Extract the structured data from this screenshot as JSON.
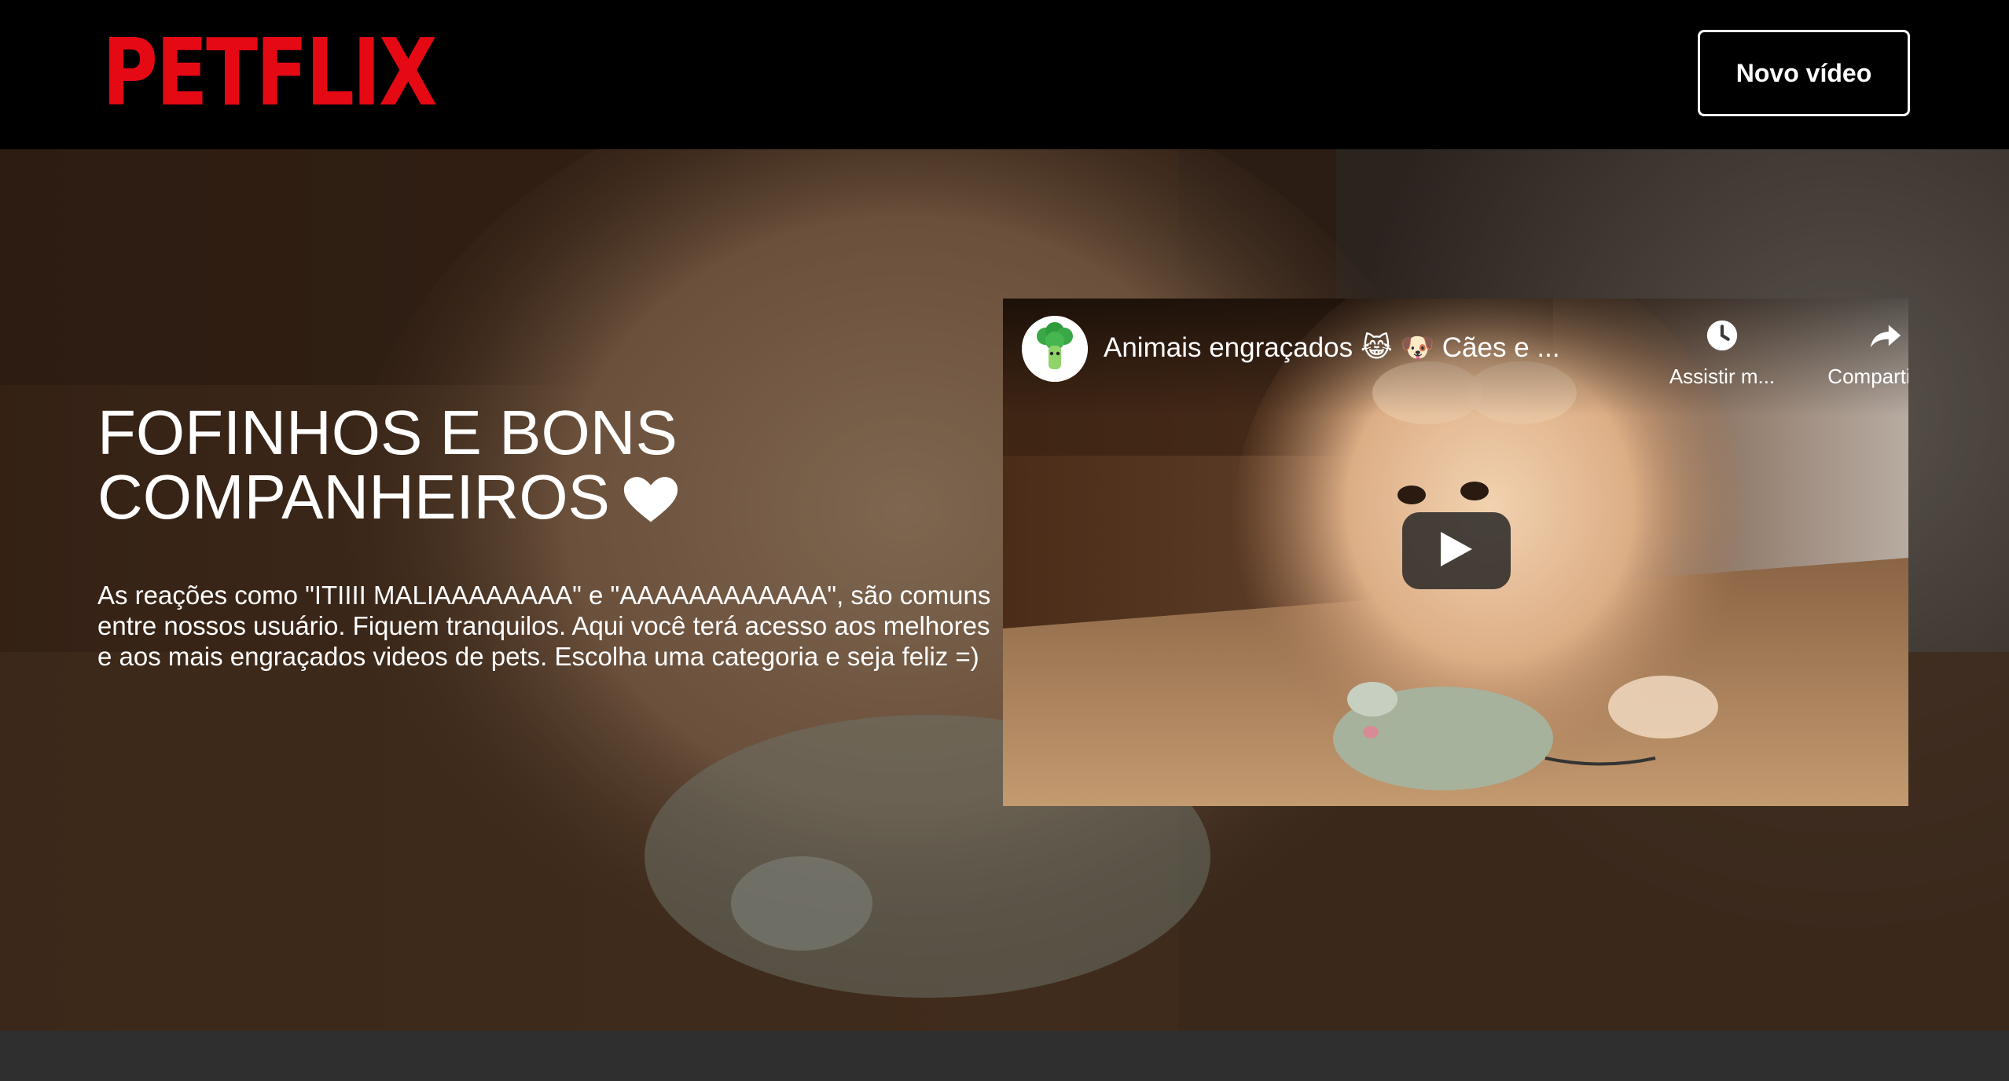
{
  "header": {
    "logo_text": "PETFLIX",
    "new_video_label": "Novo vídeo"
  },
  "hero": {
    "title_line1": "FOFINHOS E BONS",
    "title_line2": "COMPANHEIROS",
    "description": "As reações como \"ITIIII MALIAAAAAAAA\" e \"AAAAAAAAAAAA\", são comuns entre nossos usuário. Fiquem tranquilos. Aqui você terá acesso aos melhores e aos mais engraçados videos de pets. Escolha uma categoria e seja feliz =)"
  },
  "video": {
    "title": "Animais engraçados 😹 🐶 Cães e ...",
    "watch_later_label": "Assistir m...",
    "share_label": "Compartilh...",
    "icons": {
      "avatar": "broccoli-avatar-icon",
      "watch_later": "clock-icon",
      "share": "share-arrow-icon",
      "play": "play-icon"
    }
  },
  "colors": {
    "brand": "#e50914",
    "header_bg": "#000000",
    "footer_strip": "#2f2f2f"
  }
}
